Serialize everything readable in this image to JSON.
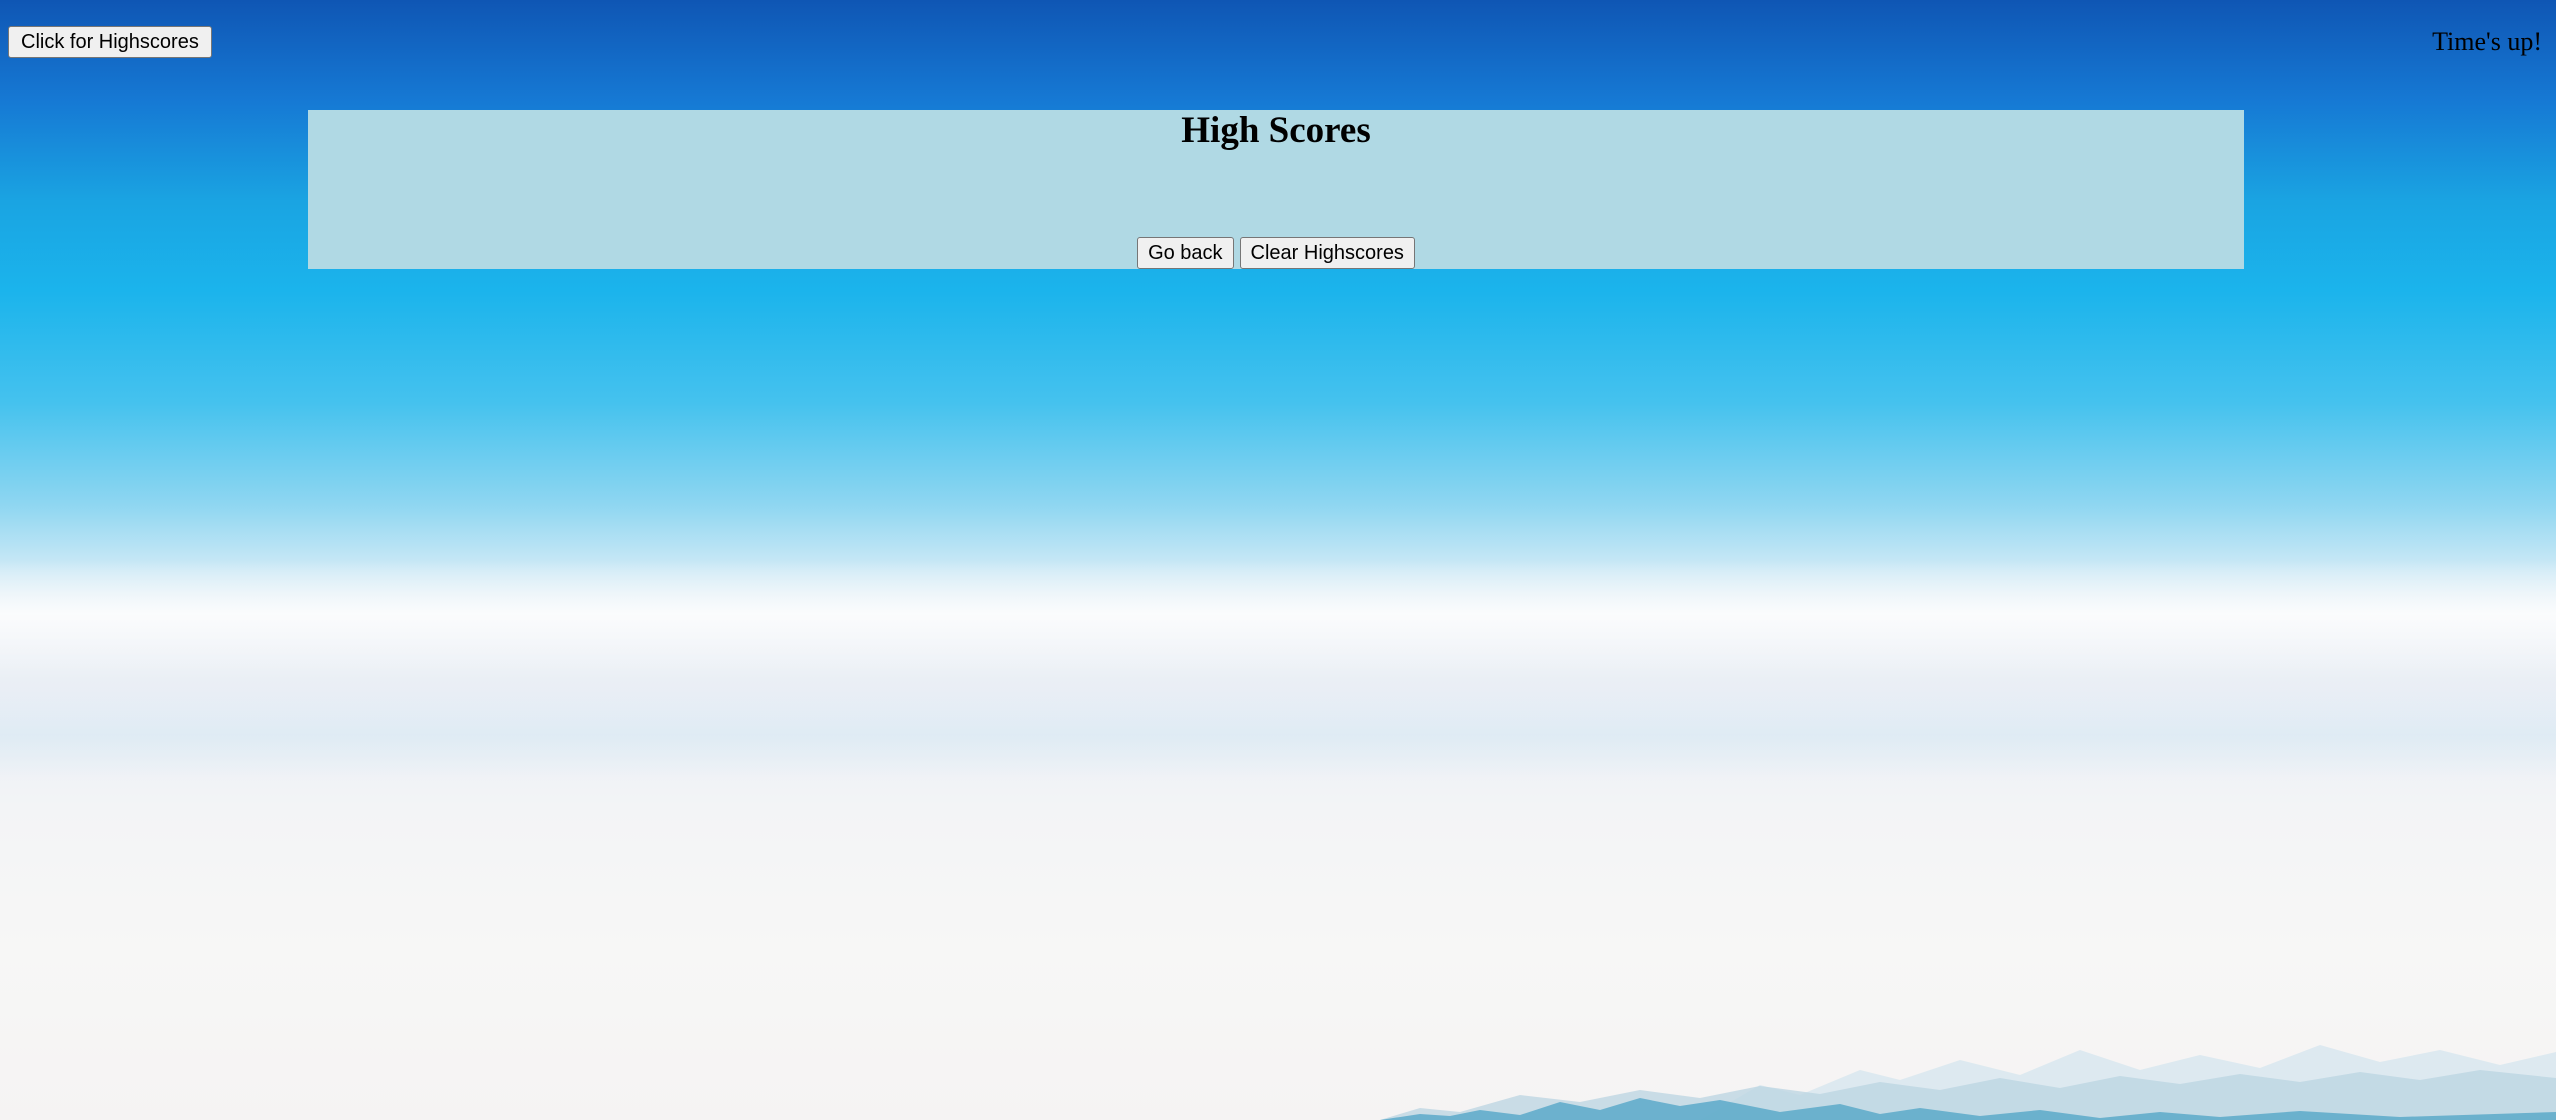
{
  "header": {
    "highscores_button_label": "Click for Highscores",
    "timer_text": "Time's up!"
  },
  "highscores_panel": {
    "title": "High Scores",
    "scores": [],
    "go_back_label": "Go back",
    "clear_label": "Clear Highscores"
  },
  "colors": {
    "panel_background": "#b0d9e4",
    "sky_top": "#0f56b4",
    "sky_bottom": "#f7f7f6"
  }
}
